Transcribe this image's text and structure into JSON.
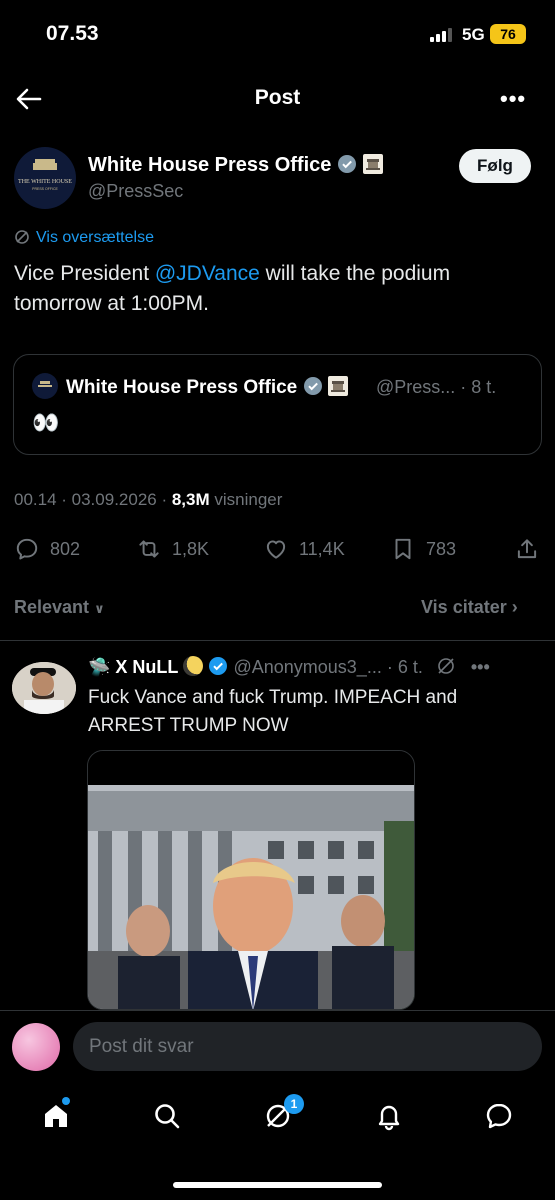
{
  "status_bar": {
    "time": "07.53",
    "network": "5G",
    "battery": "76"
  },
  "header": {
    "title": "Post"
  },
  "post": {
    "author_name": "White House Press Office",
    "handle": "@PressSec",
    "follow_label": "Følg",
    "avatar_text": "THE WHITE HOUSE",
    "translate_label": "Vis oversættelse",
    "text_before": "Vice President ",
    "mention": "@JDVance",
    "text_after": " will take the podium tomorrow at 1:00PM.",
    "timestamp": "00.14 · 03.09.2026 · ",
    "views_count": "8,3M",
    "views_label": " visninger"
  },
  "quoted": {
    "author_name": "White House Press Office",
    "meta": "@Press... · 8 t.",
    "content": "👀"
  },
  "actions": {
    "replies": "802",
    "reposts": "1,8K",
    "likes": "11,4K",
    "bookmarks": "783"
  },
  "sort": {
    "relevant_label": "Relevant",
    "quotes_label": "Vis citater"
  },
  "reply": {
    "name_prefix": "🛸 ",
    "name": "X NuLL",
    "handle_meta": "@Anonymous3_... · 6 t.",
    "text": "Fuck Vance and fuck Trump. IMPEACH and ARREST TRUMP NOW"
  },
  "composer": {
    "placeholder": "Post dit svar"
  },
  "tabbar": {
    "notifications_badge": "1"
  },
  "colors": {
    "accent": "#1d9bf0",
    "muted": "#71767b",
    "border": "#2f3336",
    "battery": "#f5c518"
  }
}
